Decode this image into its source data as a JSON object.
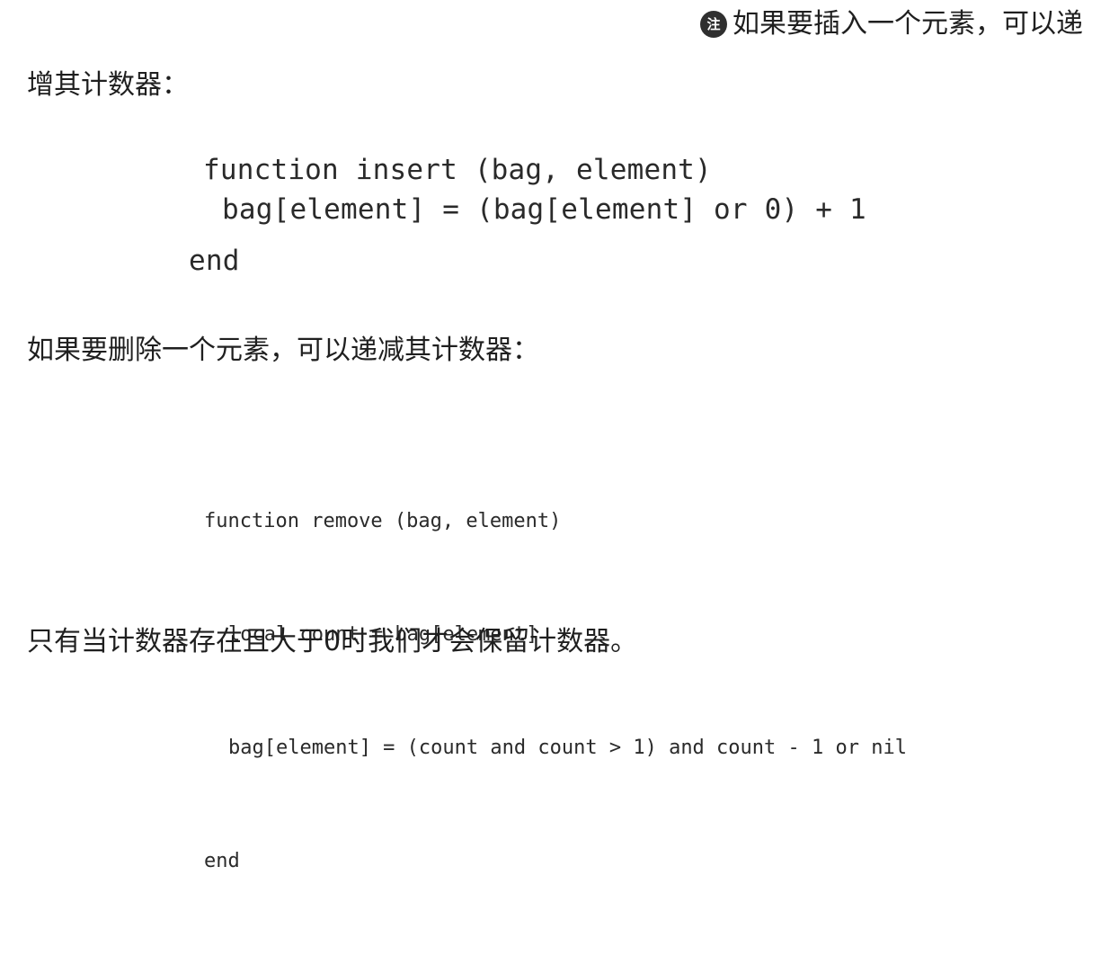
{
  "top_note": {
    "badge": "注",
    "text": "如果要插入一个元素，可以递"
  },
  "paragraphs": {
    "insert_intro": "增其计数器：",
    "remove_intro": "如果要删除一个元素，可以递减其计数器：",
    "conclusion": "只有当计数器存在且大于0时我们才会保留计数器。"
  },
  "code": {
    "insert": [
      "function insert (bag, element)",
      "bag[element] = (bag[element] or 0) + 1",
      "end"
    ],
    "remove": [
      "function remove (bag, element)",
      "local count = bag[element]",
      "bag[element] = (count and count > 1) and count - 1 or nil",
      "end"
    ]
  }
}
